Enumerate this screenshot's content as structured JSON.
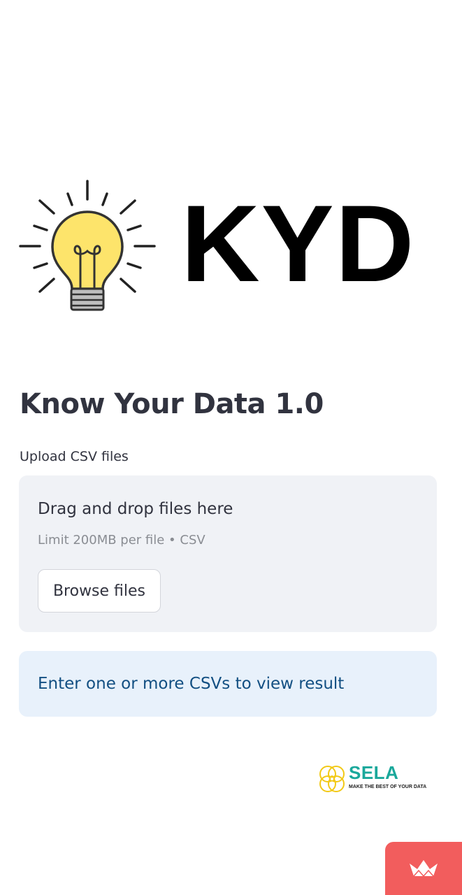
{
  "logo": {
    "text": "KYD",
    "icon": "light-bulb-icon"
  },
  "main": {
    "title": "Know Your Data 1.0",
    "uploader": {
      "label": "Upload CSV files",
      "drop_text": "Drag and drop files here",
      "limit_text": "Limit 200MB per file • CSV",
      "browse_label": "Browse files"
    },
    "info_message": "Enter one or more CSVs to view result"
  },
  "footer_logo": {
    "name": "SELA",
    "tagline": "MAKE THE BEST OF YOUR DATA",
    "icon": "sela-circles-icon"
  },
  "badge": {
    "icon": "crown-icon"
  },
  "colors": {
    "background": "#ffffff",
    "text": "#31333f",
    "dropzone_bg": "#f0f2f6",
    "info_bg": "#e8f1fb",
    "info_text": "#124f82",
    "bulb_yellow": "#fde46b",
    "sela_teal": "#1aa89b",
    "badge_red": "#f25d5d"
  }
}
